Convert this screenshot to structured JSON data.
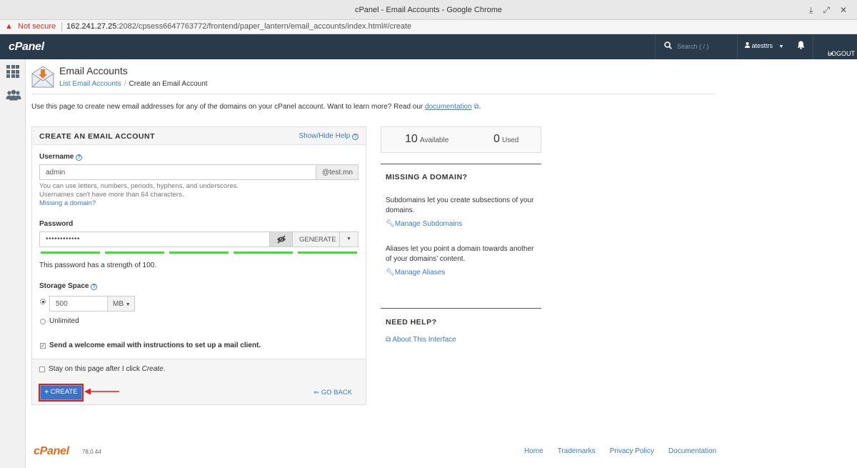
{
  "window": {
    "title": "cPanel - Email Accounts - Google Chrome"
  },
  "address_bar": {
    "security": "Not secure",
    "host": "162.241.27.25",
    "path": ":2082/cpsess6647763772/frontend/paper_lantern/email_accounts/index.html#/create"
  },
  "topnav": {
    "logo": "cPanel",
    "search_placeholder": "Search ( / )",
    "username": "atesttrs",
    "logout_label": "LOGOUT"
  },
  "header": {
    "title": "Email Accounts",
    "breadcrumb": {
      "link": "List Email Accounts",
      "current": "Create an Email Account"
    }
  },
  "intro": {
    "text": "Use this page to create new email addresses for any of the domains on your cPanel account. Want to learn more? Read our ",
    "link": "documentation",
    "end": "."
  },
  "create_panel": {
    "title": "CREATE AN EMAIL ACCOUNT",
    "help_toggle": "Show/Hide Help",
    "username": {
      "label": "Username",
      "value": "admin",
      "domain": "@test.mn",
      "hint1": "You can use letters, numbers, periods, hyphens, and underscores.",
      "hint2": "Usernames can't have more than 64 characters.",
      "missing_domain": "Missing a domain?"
    },
    "password": {
      "label": "Password",
      "value": "••••••••••••",
      "generate": "GENERATE",
      "strength_text": "This password has a strength of 100.",
      "strength": 100
    },
    "storage": {
      "label": "Storage Space",
      "value": "500",
      "unit": "MB",
      "unlimited": "Unlimited"
    },
    "welcome_email": "Send a welcome email with instructions to set up a mail client.",
    "stay_text": "Stay on this page after I click ",
    "stay_em": "Create",
    "stay_end": ".",
    "create_button": "CREATE",
    "go_back": "GO BACK"
  },
  "quota": {
    "available": "10",
    "available_label": "Available",
    "used": "0",
    "used_label": "Used"
  },
  "missing_domain_box": {
    "title": "MISSING A DOMAIN?",
    "subdomains_text": "Subdomains let you create subsections of your domains.",
    "subdomains_link": "Manage Subdomains",
    "aliases_text": "Aliases let you point a domain towards another of your domains’ content.",
    "aliases_link": "Manage Aliases"
  },
  "help_box": {
    "title": "NEED HELP?",
    "link": "About This Interface"
  },
  "footer": {
    "logo": "cPanel",
    "version": "78.0.44",
    "links": [
      "Home",
      "Trademarks",
      "Privacy Policy",
      "Documentation"
    ]
  },
  "colors": {
    "accent": "#3b73c8",
    "nav": "#293a4a",
    "strength": "#44dd33",
    "highlight": "#e0201b",
    "brand": "#e06b1f"
  }
}
